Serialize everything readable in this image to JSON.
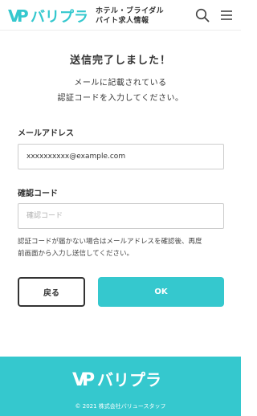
{
  "header": {
    "logo_text": "バリプラ",
    "tagline_line1": "ホテル・ブライダル",
    "tagline_line2": "バイト求人情報",
    "search_icon": "search-icon",
    "menu_icon": "hamburger-menu-icon"
  },
  "main": {
    "title": "送信完了しました！",
    "lead_line1": "メールに記載されている",
    "lead_line2": "認証コードを入力してください。",
    "email_label": "メールアドレス",
    "email_value": "xxxxxxxxxx@example.com",
    "code_label": "確認コード",
    "code_placeholder": "確認コード",
    "note_line1": "認証コードが届かない場合はメールアドレスを確認後、再度",
    "note_line2": "前画面から入力し送信してください。",
    "back_label": "戻る",
    "ok_label": "OK"
  },
  "footer": {
    "logo_text": "バリプラ",
    "copyright": "© 2021 株式会社バリュースタッフ"
  },
  "colors": {
    "brand": "#35c8ce",
    "text": "#333333"
  }
}
